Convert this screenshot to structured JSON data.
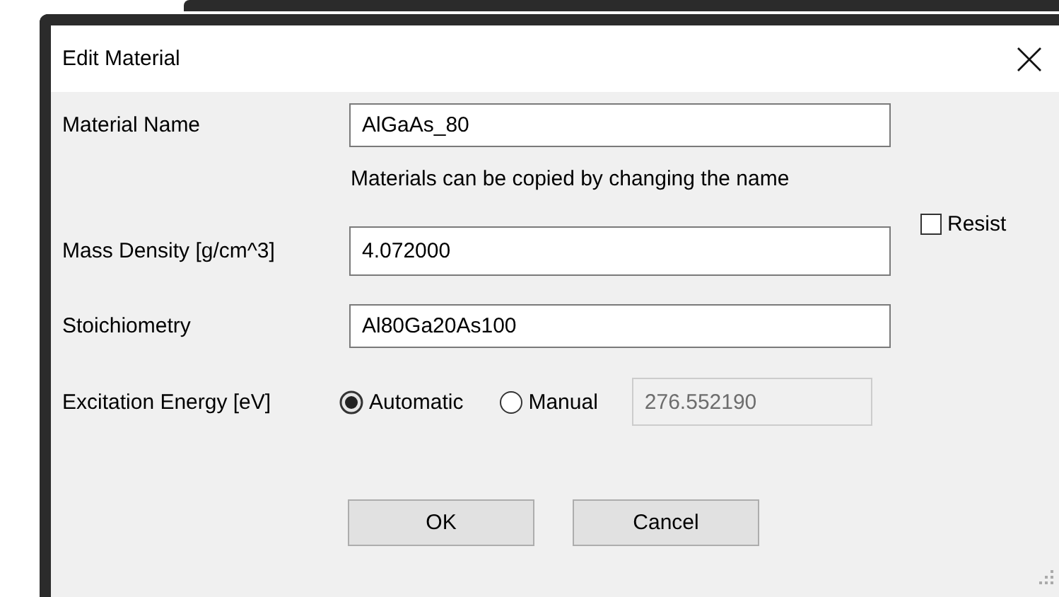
{
  "window": {
    "title": "Edit Material"
  },
  "material_name": {
    "label": "Material Name",
    "value": "AlGaAs_80"
  },
  "hint": "Materials can be copied by changing the name",
  "mass_density": {
    "label": "Mass Density [g/cm^3]",
    "value": "4.072000"
  },
  "resist": {
    "label": "Resist",
    "checked": false
  },
  "stoichiometry": {
    "label": "Stoichiometry",
    "value": "Al80Ga20As100"
  },
  "excitation_energy": {
    "label": "Excitation Energy [eV]",
    "options": [
      {
        "label": "Automatic",
        "selected": true
      },
      {
        "label": "Manual",
        "selected": false
      }
    ],
    "manual_value": {
      "value": "276.552190",
      "disabled": true
    }
  },
  "buttons": [
    {
      "label": "OK"
    },
    {
      "label": "Cancel"
    }
  ]
}
